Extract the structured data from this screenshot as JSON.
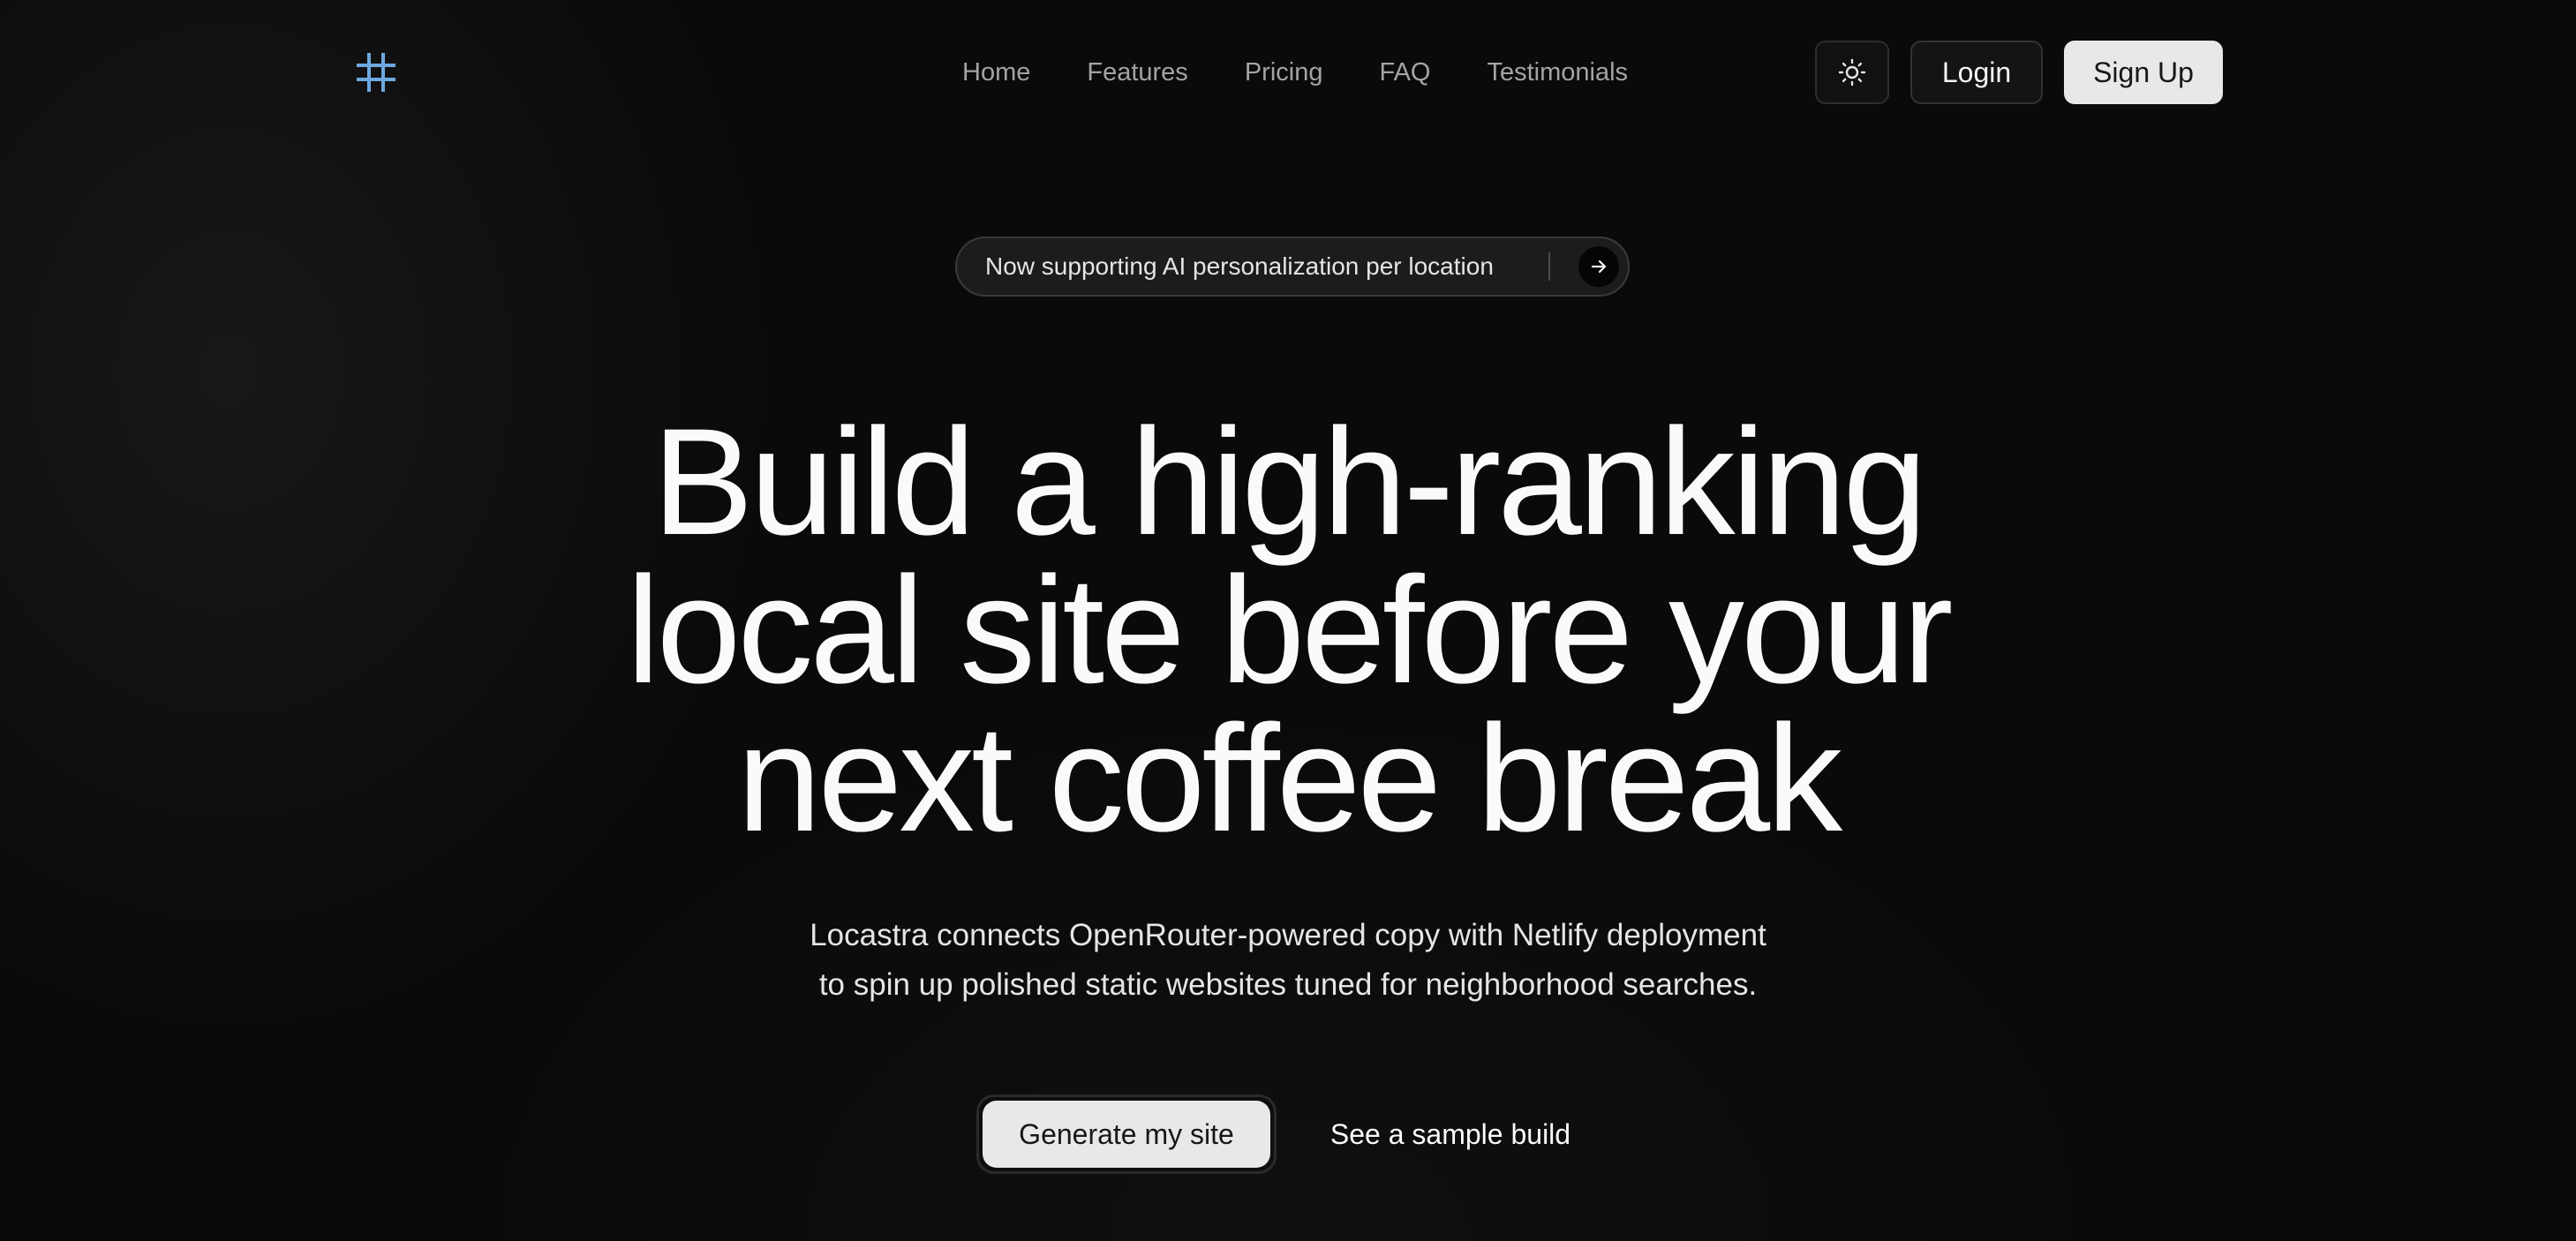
{
  "brand": {
    "logo_icon": "hash-grid-icon",
    "logo_color": "#6ea8e0"
  },
  "nav": {
    "links": [
      {
        "label": "Home"
      },
      {
        "label": "Features"
      },
      {
        "label": "Pricing"
      },
      {
        "label": "FAQ"
      },
      {
        "label": "Testimonials"
      }
    ]
  },
  "header_actions": {
    "theme_toggle_icon": "sun-icon",
    "login_label": "Login",
    "signup_label": "Sign Up"
  },
  "announcement": {
    "text": "Now supporting AI personalization per location",
    "icon": "arrow-right-icon"
  },
  "hero": {
    "title_lines": [
      "Build a high-ranking",
      "local site before your",
      "next coffee break"
    ],
    "subtitle_lines": [
      "Locastra connects OpenRouter-powered copy with Netlify deployment",
      "to spin up polished static websites tuned for neighborhood searches."
    ],
    "primary_cta": "Generate my site",
    "secondary_cta": "See a sample build"
  },
  "colors": {
    "background": "#0a0a0a",
    "text": "#fafafa",
    "muted_text": "#a3a3a3",
    "button_light": "#e8e8e8",
    "accent": "#6ea8e0"
  }
}
